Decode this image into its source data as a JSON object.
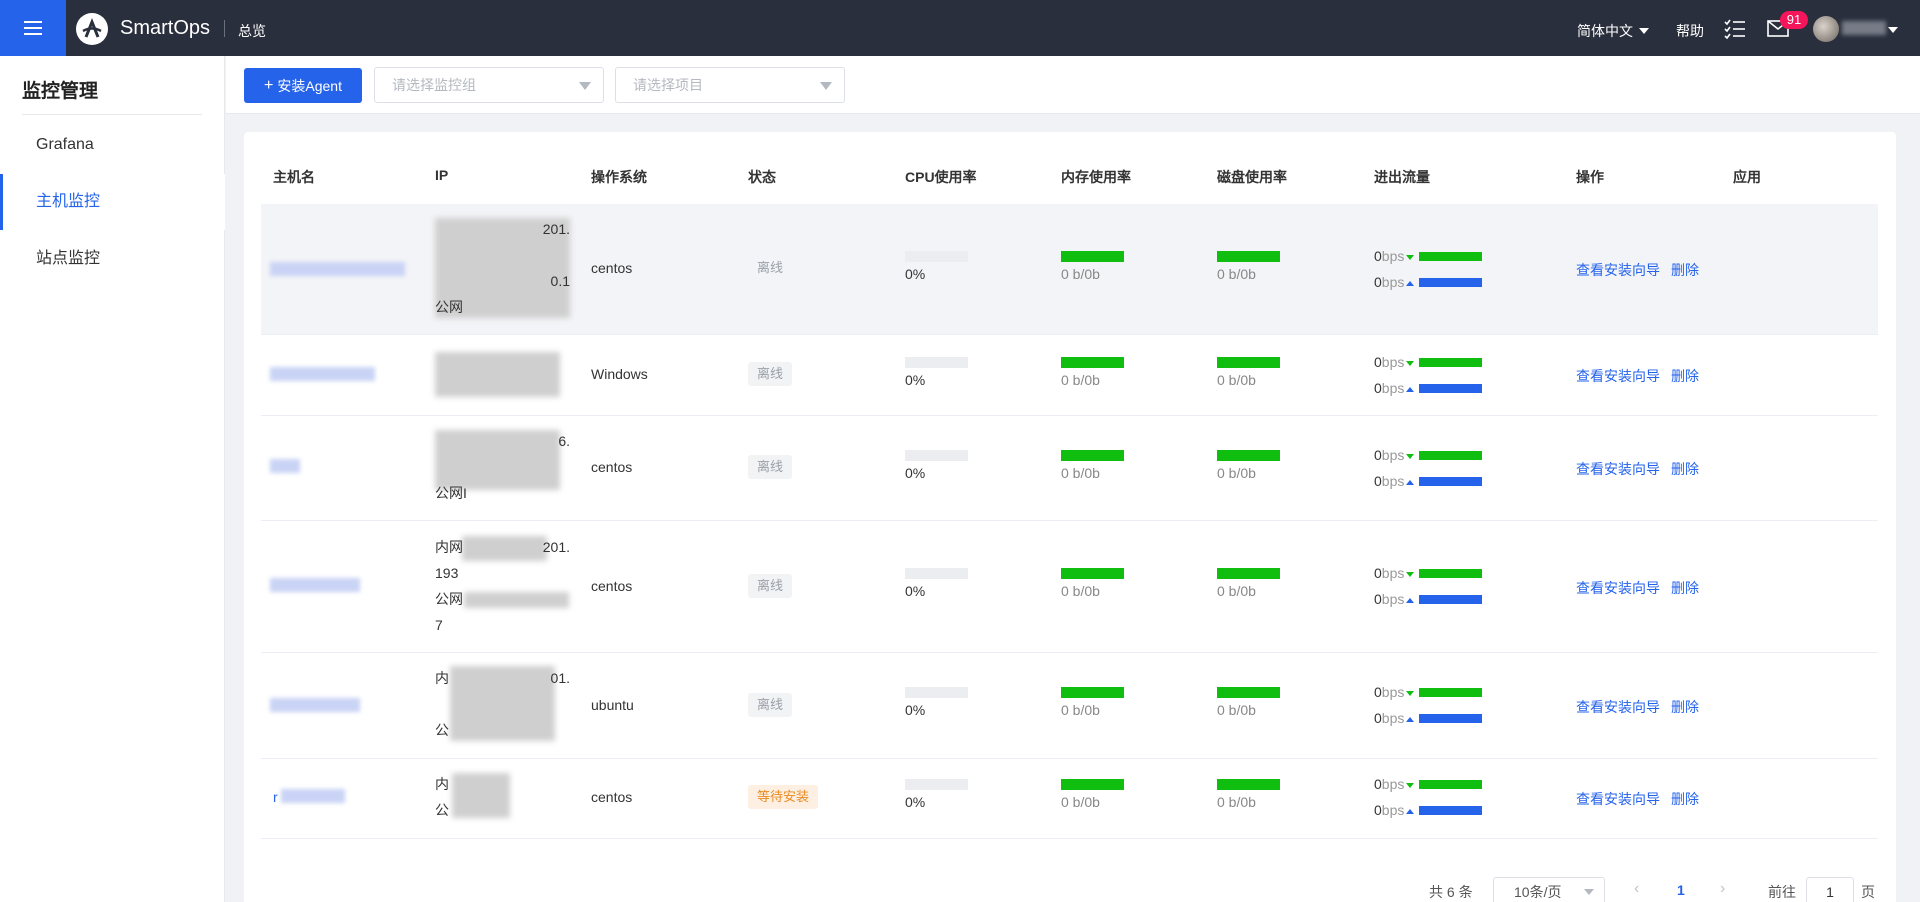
{
  "header": {
    "brand": "SmartOps",
    "breadcrumb": "总览",
    "language": "简体中文",
    "help": "帮助",
    "mail_badge": "91"
  },
  "sidebar": {
    "title": "监控管理",
    "items": [
      {
        "label": "Grafana"
      },
      {
        "label": "主机监控"
      },
      {
        "label": "站点监控"
      }
    ]
  },
  "toolbar": {
    "install_label": "安装Agent",
    "group_placeholder": "请选择监控组",
    "project_placeholder": "请选择项目"
  },
  "table": {
    "headers": [
      "主机名",
      "IP",
      "操作系统",
      "状态",
      "CPU使用率",
      "内存使用率",
      "磁盘使用率",
      "进出流量",
      "操作",
      "应用"
    ],
    "rows": [
      {
        "ip": [
          "201.",
          "",
          "0.1",
          "公网"
        ],
        "os": "centos",
        "status": "离线",
        "cpu": "0%",
        "mem": "0 b/0b",
        "disk": "0 b/0b",
        "in_val": "0",
        "out_val": "0",
        "bps": "bps"
      },
      {
        "ip": [
          "",
          ""
        ],
        "os": "Windows",
        "status": "离线",
        "cpu": "0%",
        "mem": "0 b/0b",
        "disk": "0 b/0b",
        "in_val": "0",
        "out_val": "0",
        "bps": "bps"
      },
      {
        "ip": [
          "6.",
          "",
          "公网I"
        ],
        "os": "centos",
        "status": "离线",
        "cpu": "0%",
        "mem": "0 b/0b",
        "disk": "0 b/0b",
        "in_val": "0",
        "out_val": "0",
        "bps": "bps"
      },
      {
        "ip": [
          "内网",
          "193",
          "公网",
          "7"
        ],
        "ip_tail": "201.",
        "os": "centos",
        "status": "离线",
        "cpu": "0%",
        "mem": "0 b/0b",
        "disk": "0 b/0b",
        "in_val": "0",
        "out_val": "0",
        "bps": "bps"
      },
      {
        "ip": [
          "内",
          "",
          "公"
        ],
        "ip_tail": "01.",
        "os": "ubuntu",
        "status": "离线",
        "cpu": "0%",
        "mem": "0 b/0b",
        "disk": "0 b/0b",
        "in_val": "0",
        "out_val": "0",
        "bps": "bps"
      },
      {
        "host_prefix": "r",
        "ip": [
          "内",
          "公"
        ],
        "os": "centos",
        "status": "等待安装",
        "cpu": "0%",
        "mem": "0 b/0b",
        "disk": "0 b/0b",
        "in_val": "0",
        "out_val": "0",
        "bps": "bps"
      }
    ],
    "action_guide": "查看安装向导",
    "action_delete": "删除"
  },
  "pagination": {
    "total": "共 6 条",
    "page_size": "10条/页",
    "current": "1",
    "goto_label": "前往",
    "goto_value": "1",
    "goto_unit": "页"
  }
}
